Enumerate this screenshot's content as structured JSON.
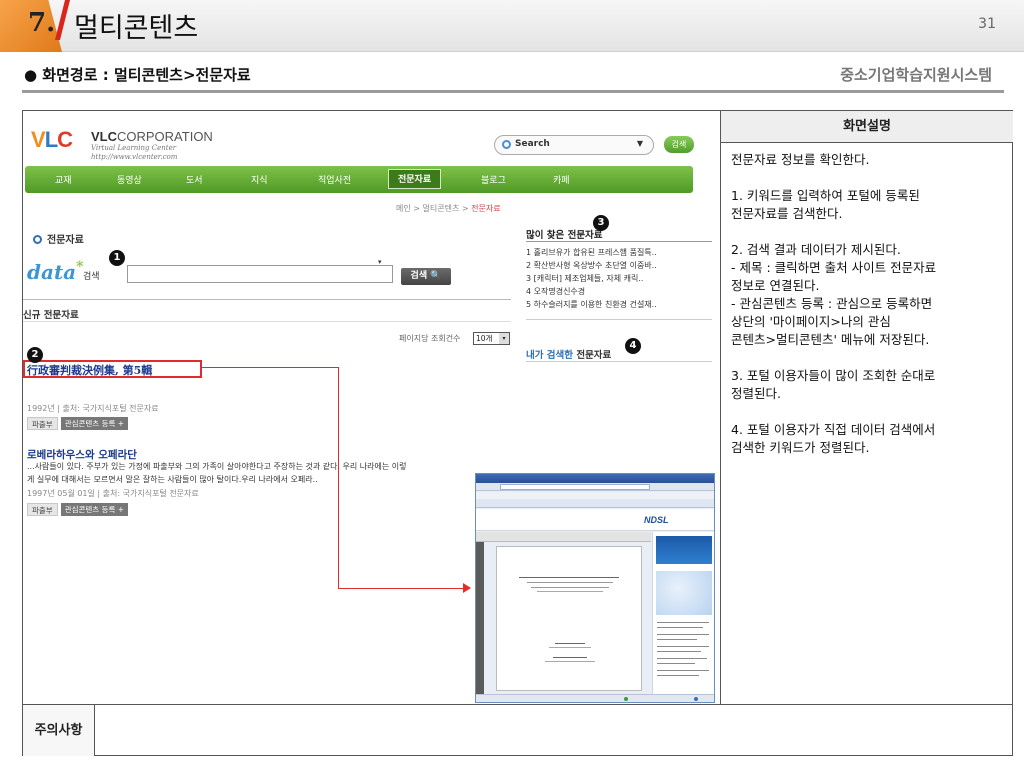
{
  "header": {
    "section_number": "7.",
    "title": "멀티콘텐츠",
    "page_number": "31"
  },
  "subheader": {
    "path": "● 화면경로 : 멀티콘텐츠>전문자료",
    "system_name": "중소기업학습지원시스템"
  },
  "description": {
    "heading": "화면설명",
    "paragraphs": [
      "전문자료 정보를 확인한다.",
      "1. 키워드를 입력하여 포털에 등록된\n 전문자료를 검색한다.",
      "2. 검색 결과 데이터가 제시된다.\n - 제목 : 클릭하면 출처 사이트 전문자료\n 정보로 연결된다.\n - 관심콘텐츠 등록 : 관심으로 등록하면\n 상단의 '마이페이지>나의 관심\n 콘텐츠>멀티콘텐츠' 메뉴에 저장된다.",
      "3. 포털 이용자들이 많이 조회한 순대로\n 정렬된다.",
      "4. 포털 이용자가 직접 데이터 검색에서\n 검색한 키워드가 정렬된다."
    ]
  },
  "notes": {
    "label": "주의사항",
    "content": ""
  },
  "site": {
    "logo": {
      "v": "V",
      "l": "L",
      "c": "C",
      "corp_bold": "VLC",
      "corp_rest": "CORPORATION",
      "tagline": "Virtual Learning Center",
      "url": "http://www.vlcenter.com"
    },
    "search": {
      "placeholder": "Search",
      "button": "검색"
    },
    "nav": [
      "교재",
      "동영상",
      "도서",
      "지식",
      "직업사전",
      "전문자료",
      "블로그",
      "카페"
    ],
    "active_nav": "전문자료",
    "breadcrumb": {
      "trail": "메인 > 멀티콘텐츠 > ",
      "current": "전문자료"
    },
    "section_title": "전문자료",
    "data_search": {
      "logo": "data",
      "star": "*",
      "label": "검색",
      "button": "검색 🔍",
      "dropdown": "▾"
    },
    "new_list_title": "신규 전문자료",
    "per_page": {
      "label": "페이지당 조회건수",
      "value": "10개",
      "arrow": "▾"
    },
    "items": [
      {
        "title": "行政審判裁決例集, 第5輯",
        "meta": "1992년  |  출처: 국가지식포털 전문자료",
        "tag1": "파출부",
        "tag2": "관심콘텐츠 등록  +"
      },
      {
        "title": "로베라하우스와 오페라단",
        "desc1": "...사람들이 있다. 주부가 있는 가정에 파출부와 그의 가족이 살아야한다고 주장하는 것과 같다. 우리 나라에는 이렇",
        "desc2": "게 실무에 대해서는 모르면서 말은 잘하는 사람들이 많아 탈이다.우리 나라에서 오페라..",
        "meta": "1997년 05월 01일  |  출처: 국가지식포털 전문자료",
        "tag1": "파출부",
        "tag2": "관심콘텐츠 등록  +"
      }
    ],
    "popular": {
      "title": "많이 찾은 전문자료",
      "items": [
        "1  홀리브유가 합유된 프레스햄 품질특..",
        "2  확산반사형 옥상방수 초단열 이중바..",
        "3  [캐릭터] 제조업체들, 자체 캐릭..",
        "4  오작명경신수경",
        "5  하수슬러지를 이용한 친환경 건설재.."
      ]
    },
    "my_search": {
      "title_blue": "내가 검색한",
      "title_rest": " 전문자료"
    }
  },
  "badges": [
    "1",
    "2",
    "3",
    "4"
  ],
  "colors": {
    "nav_green": "#5aa530",
    "highlight_red": "#e32b2b",
    "link_blue": "#1b3b8c",
    "header_orange": "#ef8e2a"
  }
}
